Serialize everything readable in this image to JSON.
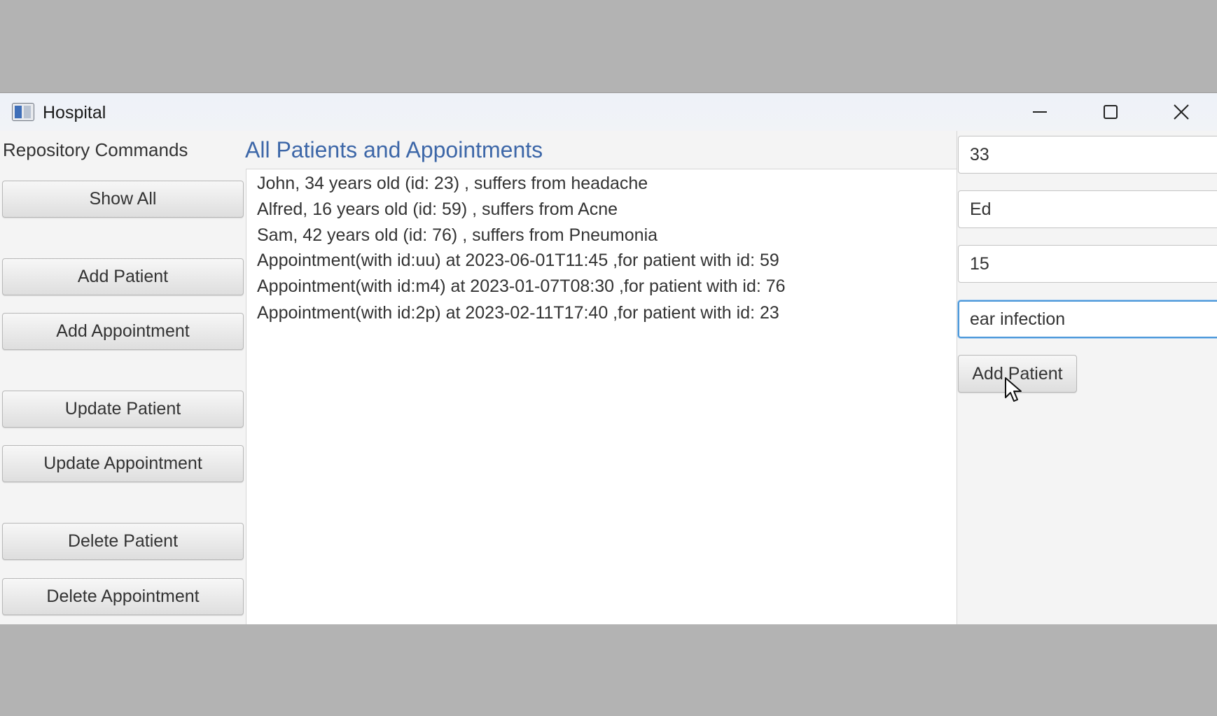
{
  "window": {
    "title": "Hospital",
    "icon": "app-window-icon",
    "controls": [
      "minimize-icon",
      "maximize-icon",
      "close-icon"
    ]
  },
  "sidebar": {
    "heading": "Repository Commands",
    "buttons": [
      {
        "label": "Show All"
      },
      {
        "label": "Add Patient"
      },
      {
        "label": "Add Appointment"
      },
      {
        "label": "Update Patient"
      },
      {
        "label": "Update Appointment"
      },
      {
        "label": "Delete Patient"
      },
      {
        "label": "Delete Appointment"
      }
    ]
  },
  "main": {
    "title": "All Patients and Appointments",
    "items": [
      "John, 34 years old (id: 23) , suffers from headache",
      "Alfred, 16 years old (id: 59) , suffers from Acne",
      "Sam, 42 years old (id: 76) , suffers from Pneumonia",
      "Appointment(with id:uu) at 2023-06-01T11:45 ,for patient with id: 59",
      "Appointment(with id:m4) at 2023-01-07T08:30 ,for patient with id: 76",
      "Appointment(with id:2p) at 2023-02-11T17:40 ,for patient with id: 23"
    ]
  },
  "form": {
    "fields": [
      {
        "value": "33"
      },
      {
        "value": "Ed"
      },
      {
        "value": "15"
      },
      {
        "value": "ear infection"
      }
    ],
    "submit_label": "Add Patient"
  },
  "colors": {
    "accent": "#3d67a8",
    "focus": "#4a97d9",
    "backdrop": "#b3b3b3"
  }
}
